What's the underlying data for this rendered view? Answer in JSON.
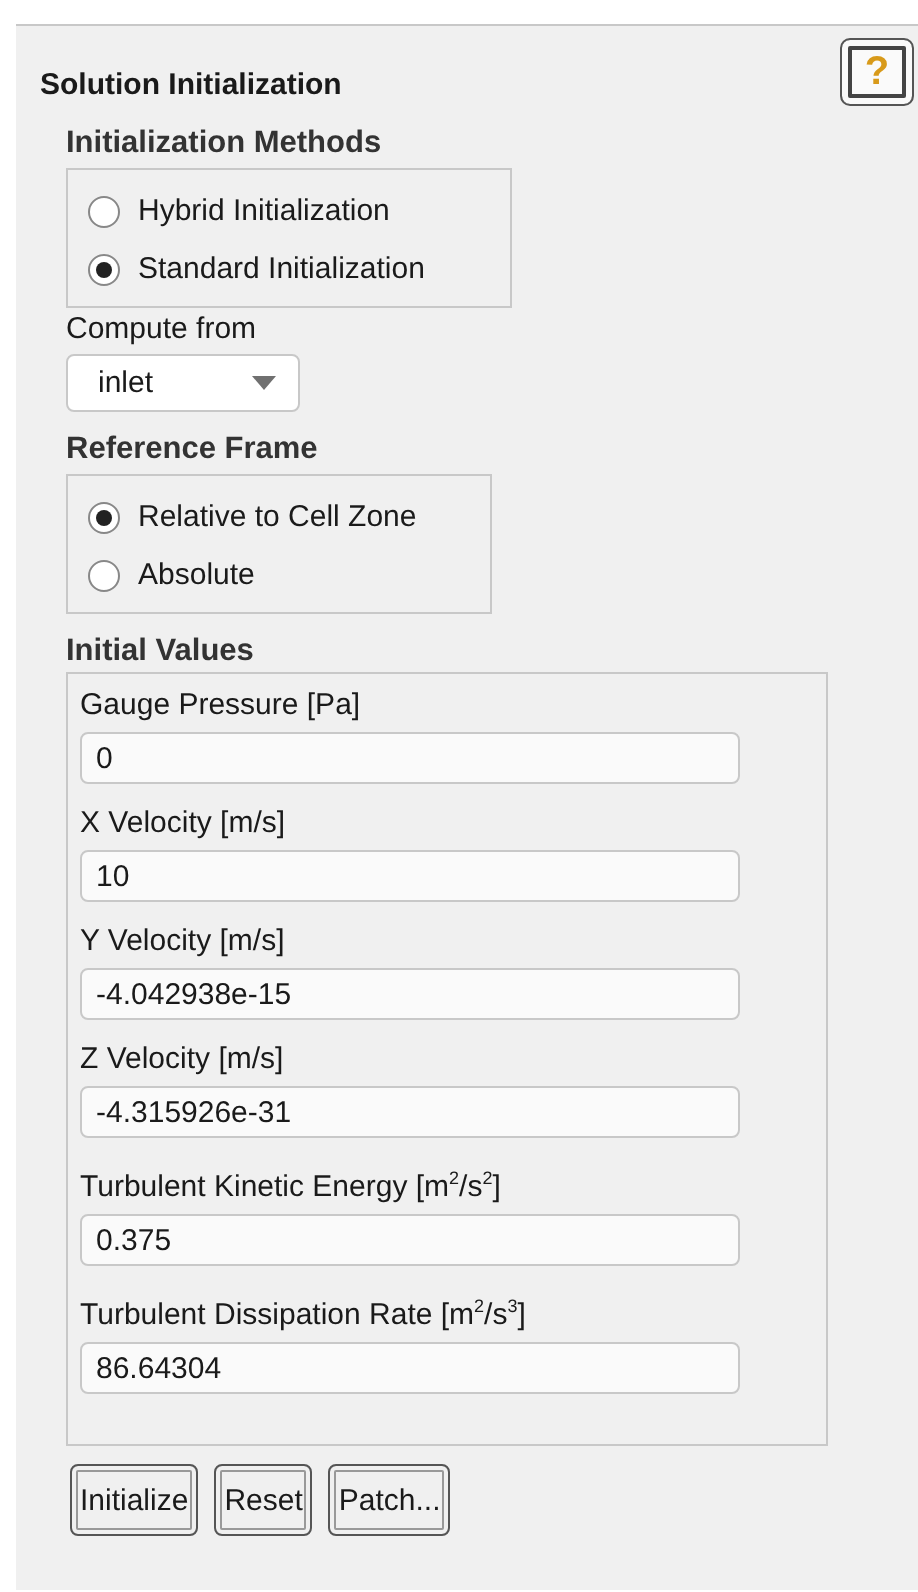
{
  "panel": {
    "title": "Solution Initialization",
    "help": "?"
  },
  "methods": {
    "title": "Initialization Methods",
    "options": [
      {
        "label": "Hybrid  Initialization",
        "selected": false
      },
      {
        "label": "Standard Initialization",
        "selected": true
      }
    ]
  },
  "compute_from": {
    "label": "Compute from",
    "value": "inlet"
  },
  "reference_frame": {
    "title": "Reference Frame",
    "options": [
      {
        "label": "Relative to Cell Zone",
        "selected": true
      },
      {
        "label": "Absolute",
        "selected": false
      }
    ]
  },
  "initial_values": {
    "title": "Initial Values",
    "fields": [
      {
        "label": "Gauge Pressure [Pa]",
        "value": "0"
      },
      {
        "label": "X Velocity [m/s]",
        "value": "10"
      },
      {
        "label": "Y Velocity [m/s]",
        "value": "-4.042938e-15"
      },
      {
        "label": "Z Velocity [m/s]",
        "value": "-4.315926e-31"
      },
      {
        "label": "Turbulent Kinetic Energy [m$^{2}$/s$^{2}$]",
        "value": "0.375"
      },
      {
        "label": "Turbulent Dissipation Rate [m$^{2}$/s$^{3}$]",
        "value": "86.64304"
      }
    ]
  },
  "buttons": [
    "Initialize",
    "Reset",
    "Patch..."
  ]
}
